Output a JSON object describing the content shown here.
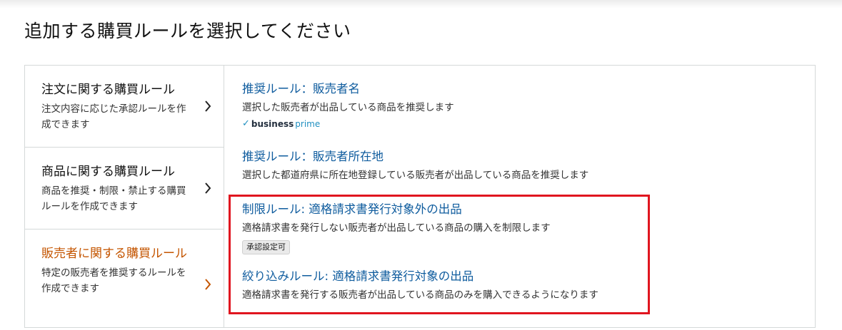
{
  "page": {
    "title": "追加する購買ルールを選択してください"
  },
  "categories": [
    {
      "title": "注文に関する購買ルール",
      "desc": "注文内容に応じた承認ルールを作成できます",
      "active": false
    },
    {
      "title": "商品に関する購買ルール",
      "desc": "商品を推奨・制限・禁止する購買ルールを作成できます",
      "active": false
    },
    {
      "title": "販売者に関する購買ルール",
      "desc": "特定の販売者を推奨するルールを作成できます",
      "active": true
    }
  ],
  "rules": [
    {
      "title": "推奨ルール：販売者名",
      "desc": "選択した販売者が出品している商品を推奨します",
      "badge_business": "business",
      "badge_prime": "prime"
    },
    {
      "title": "推奨ルール：販売者所在地",
      "desc": "選択した都道府県に所在地登録している販売者が出品している商品を推奨します"
    },
    {
      "title": "制限ルール: 適格請求書発行対象外の出品",
      "desc": "適格請求書を発行しない販売者が出品している商品の購入を制限します",
      "tag": "承認設定可"
    },
    {
      "title": "絞り込みルール: 適格請求書発行対象の出品",
      "desc": "適格請求書を発行する販売者が出品している商品のみを購入できるようになります"
    }
  ],
  "colors": {
    "link": "#0f5c9e",
    "active": "#c45500",
    "highlight": "#e0151f"
  }
}
